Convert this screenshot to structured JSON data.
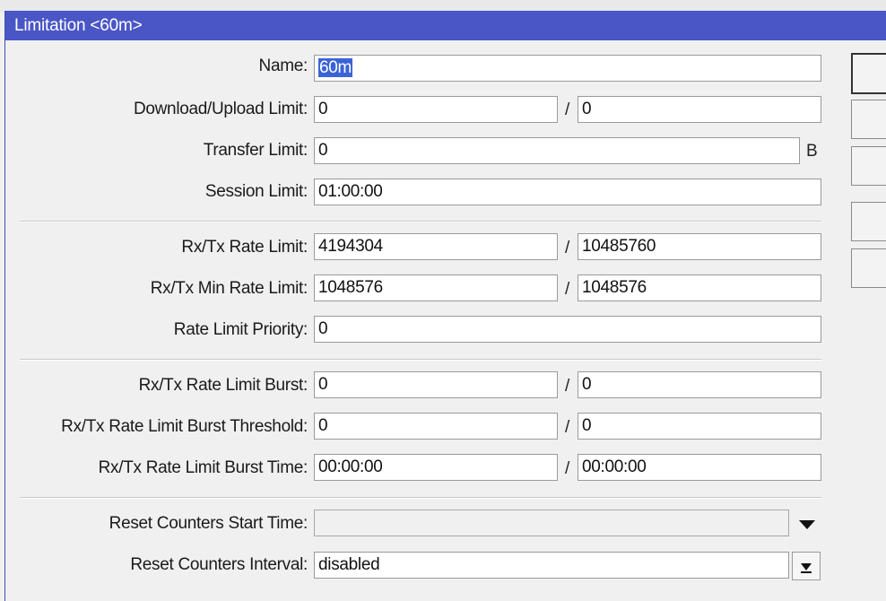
{
  "window": {
    "title": "Limitation <60m>"
  },
  "form": {
    "name": {
      "label": "Name:",
      "value": "60m"
    },
    "download_upload_limit": {
      "label": "Download/Upload Limit:",
      "value1": "0",
      "value2": "0"
    },
    "transfer_limit": {
      "label": "Transfer Limit:",
      "value": "0",
      "unit": "B"
    },
    "session_limit": {
      "label": "Session Limit:",
      "value": "01:00:00"
    },
    "rx_tx_rate_limit": {
      "label": "Rx/Tx Rate Limit:",
      "value1": "4194304",
      "value2": "10485760"
    },
    "rx_tx_min_rate_limit": {
      "label": "Rx/Tx Min Rate Limit:",
      "value1": "1048576",
      "value2": "1048576"
    },
    "rate_limit_priority": {
      "label": "Rate Limit Priority:",
      "value": "0"
    },
    "rx_tx_rate_limit_burst": {
      "label": "Rx/Tx Rate Limit Burst:",
      "value1": "0",
      "value2": "0"
    },
    "rx_tx_rate_limit_burst_threshold": {
      "label": "Rx/Tx Rate Limit Burst Threshold:",
      "value1": "0",
      "value2": "0"
    },
    "rx_tx_rate_limit_burst_time": {
      "label": "Rx/Tx Rate Limit Burst Time:",
      "value1": "00:00:00",
      "value2": "00:00:00"
    },
    "reset_counters_start_time": {
      "label": "Reset Counters Start Time:",
      "value": ""
    },
    "reset_counters_interval": {
      "label": "Reset Counters Interval:",
      "value": "disabled"
    },
    "pair_separator": "/"
  },
  "icons": {
    "dropdown": "chevron-down-icon",
    "dropdown_reset": "arrow-down-bar-icon"
  }
}
